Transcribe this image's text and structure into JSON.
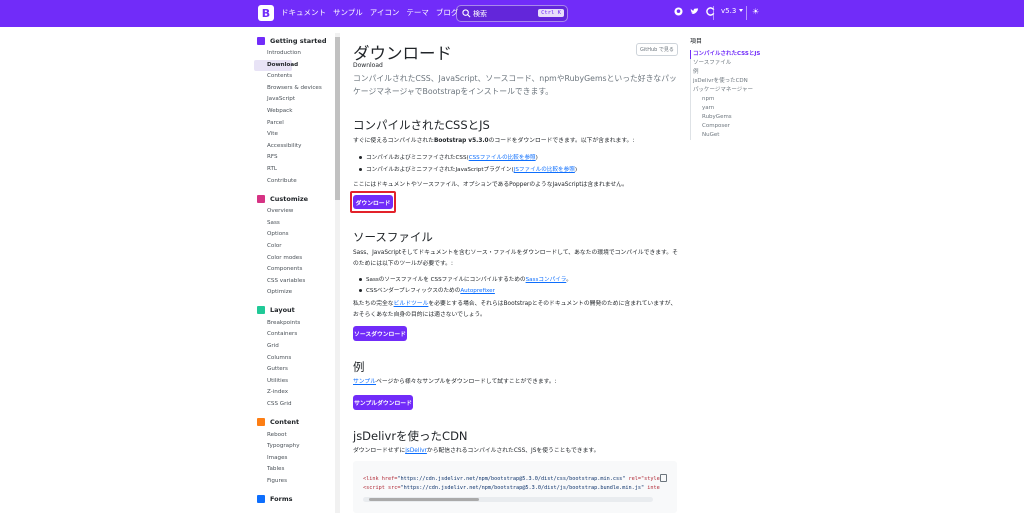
{
  "navbar": {
    "brand_text": "ドキュメント",
    "links": [
      "サンプル",
      "アイコン",
      "テーマ",
      "ブログ"
    ],
    "search_placeholder": "検索",
    "search_shortcut": "Ctrl K",
    "version": "v5.3",
    "theme_icon": "☀"
  },
  "sidebar": {
    "groups": [
      {
        "title": "Getting started",
        "icon_color": "#712cf9",
        "items": [
          "Introduction",
          "Download",
          "Contents",
          "Browsers & devices",
          "JavaScript",
          "Webpack",
          "Parcel",
          "Vite",
          "Accessibility",
          "RFS",
          "RTL",
          "Contribute"
        ]
      },
      {
        "title": "Customize",
        "icon_color": "#d63384",
        "items": [
          "Overview",
          "Sass",
          "Options",
          "Color",
          "Color modes",
          "Components",
          "CSS variables",
          "Optimize"
        ]
      },
      {
        "title": "Layout",
        "icon_color": "#20c997",
        "items": [
          "Breakpoints",
          "Containers",
          "Grid",
          "Columns",
          "Gutters",
          "Utilities",
          "Z-index",
          "CSS Grid"
        ]
      },
      {
        "title": "Content",
        "icon_color": "#fd7e14",
        "items": [
          "Reboot",
          "Typography",
          "Images",
          "Tables",
          "Figures"
        ]
      },
      {
        "title": "Forms",
        "icon_color": "#0d6efd",
        "items": []
      }
    ]
  },
  "main": {
    "title": "ダウンロード",
    "subtitle": "Download",
    "github_button": "GitHub で見る",
    "lead": "コンパイルされたCSS、JavaScript、ソースコード、npmやRubyGemsといった好きなパッケージマネージャでBootstrapをインストールできます。",
    "s1_title": "コンパイルされたCSSとJS",
    "s1_intro_a": "すぐに使えるコンパイルされた",
    "s1_intro_b": "Bootstrap v5.3.0",
    "s1_intro_c": "のコードをダウンロードできます。以下が含まれます。:",
    "s1_li1_a": "コンパイルおよびミニファイされたCSS(",
    "s1_li1_link": "CSSファイルの比較を参照",
    "s1_li1_b": ")",
    "s1_li2_a": "コンパイルおよびミニファイされたJavaScriptプラグイン(",
    "s1_li2_link": "JSファイルの比較を参照",
    "s1_li2_b": ")",
    "s1_note": "ここにはドキュメントやソースファイル、オプションであるPopperのようなJavaScriptは含まれません。",
    "s1_button": "ダウンロード",
    "s2_title": "ソースファイル",
    "s2_intro": "Sass、JavaScriptそしてドキュメントを含むソース・ファイルをダウンロードして、あなたの環境でコンパイルできます。そのためには以下のツールが必要です。:",
    "s2_li1_a": "Sassのソースファイルを CSSファイルにコンパイルするための",
    "s2_li1_link": "Sassコンパイラ",
    "s2_li1_b": "。",
    "s2_li2_a": "CSSベンダープレフィックスのための",
    "s2_li2_link": "Autoprefixer",
    "s2_para_a": "私たちの完全な",
    "s2_para_link": "ビルドツール",
    "s2_para_b": "を必要とする場合、それらはBootstrapとそのドキュメントの開発のために含まれていますが、おそらくあなた自身の目的には適さないでしょう。",
    "s2_button": "ソースダウンロード",
    "s3_title": "例",
    "s3_link": "サンプル",
    "s3_text": "ページから様々なサンプルをダウンロードして試すことができます。:",
    "s3_button": "サンプルダウンロード",
    "s4_title": "jsDelivrを使ったCDN",
    "s4_text_a": "ダウンロードせずに",
    "s4_link": "jsDelivr",
    "s4_text_b": "から配信されるコンパイルされたCSS、JSを使うこともできます。",
    "code_line1_a": "<link href=",
    "code_line1_s": "\"https://cdn.jsdelivr.net/npm/bootstrap@5.3.0/dist/css/bootstrap.min.css\"",
    "code_line1_b": " rel=\"style",
    "code_line2_a": "<script src=",
    "code_line2_s": "\"https://cdn.jsdelivr.net/npm/bootstrap@5.3.0/dist/js/bootstrap.bundle.min.js\"",
    "code_line2_b": " inte"
  },
  "toc": {
    "title": "項目",
    "items": [
      "コンパイルされたCSSとJS",
      "ソースファイル",
      "例",
      "jsDelivrを使ったCDN",
      "パッケージマネージャー",
      "npm",
      "yarn",
      "RubyGems",
      "Composer",
      "NuGet"
    ]
  }
}
